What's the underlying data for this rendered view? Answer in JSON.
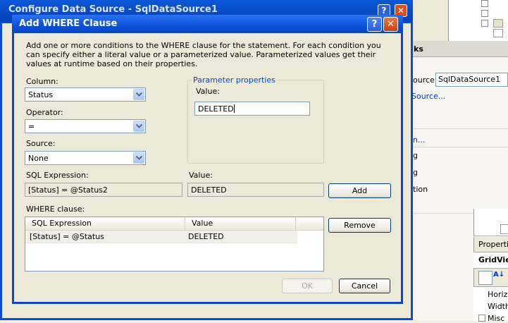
{
  "background_window": {
    "title": "Configure Data Source - SqlDataSource1"
  },
  "ide": {
    "tasks_header": "ks",
    "source_label": "ource:",
    "source_value": "SqlDataSource1",
    "source_link": "Source...",
    "link_fragment": "n...",
    "item_g1": "g",
    "item_g2": "g",
    "item_tion": "tion",
    "props_header": "Properties",
    "props_object": "GridView",
    "props_horiz": "Horizo",
    "props_width": "Width",
    "props_misc": "Misc"
  },
  "dialog": {
    "title": "Add WHERE Clause",
    "description": "Add one or more conditions to the WHERE clause for the statement. For each condition you can specify either a literal value or a parameterized value. Parameterized values get their values at runtime based on their properties.",
    "column_label": "Column:",
    "column_value": "Status",
    "operator_label": "Operator:",
    "operator_value": "=",
    "source_label": "Source:",
    "source_value": "None",
    "param_group_title": "Parameter properties",
    "param_value_label": "Value:",
    "param_value": "DELETED",
    "sql_expr_label": "SQL Expression:",
    "sql_expr_value": "[Status] = @Status2",
    "value_label": "Value:",
    "value_value": "DELETED",
    "add_button": "Add",
    "where_label": "WHERE clause:",
    "where_columns": [
      "SQL Expression",
      "Value"
    ],
    "where_rows": [
      {
        "expression": "[Status] = @Status",
        "value": "DELETED"
      }
    ],
    "remove_button": "Remove",
    "ok_button": "OK",
    "cancel_button": "Cancel"
  }
}
